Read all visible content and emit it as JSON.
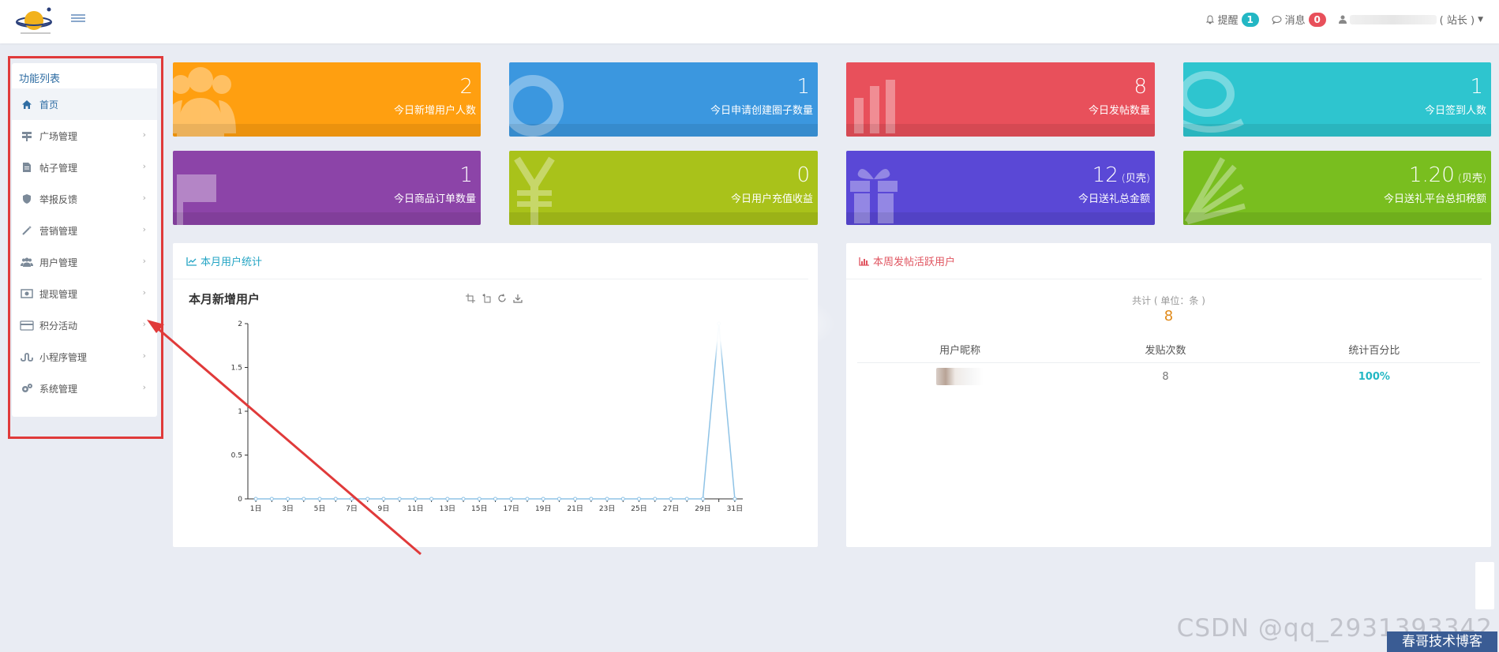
{
  "topbar": {
    "remind_label": "提醒",
    "remind_count": "1",
    "message_label": "消息",
    "message_count": "0",
    "role_label": "( 站长 )"
  },
  "sidebar": {
    "title": "功能列表",
    "items": [
      {
        "label": "首页",
        "icon": "home-icon"
      },
      {
        "label": "广场管理",
        "icon": "signpost-icon"
      },
      {
        "label": "帖子管理",
        "icon": "document-icon"
      },
      {
        "label": "举报反馈",
        "icon": "shield-icon"
      },
      {
        "label": "营销管理",
        "icon": "magic-wand-icon"
      },
      {
        "label": "用户管理",
        "icon": "users-icon"
      },
      {
        "label": "提现管理",
        "icon": "money-icon"
      },
      {
        "label": "积分活动",
        "icon": "credit-card-icon"
      },
      {
        "label": "小程序管理",
        "icon": "stumbleupon-icon"
      },
      {
        "label": "系统管理",
        "icon": "gears-icon"
      }
    ]
  },
  "cards": [
    {
      "value": "2",
      "unit": "",
      "label": "今日新增用户人数",
      "color": "#ff9f10",
      "icon": "users-icon"
    },
    {
      "value": "1",
      "unit": "",
      "label": "今日申请创建圈子数量",
      "color": "#3b97df",
      "icon": "circle-icon"
    },
    {
      "value": "8",
      "unit": "",
      "label": "今日发帖数量",
      "color": "#e8505b",
      "icon": "bar-chart-icon"
    },
    {
      "value": "1",
      "unit": "",
      "label": "今日签到人数",
      "color": "#2ec5cf",
      "icon": "ring-icon"
    },
    {
      "value": "1",
      "unit": "",
      "label": "今日商品订单数量",
      "color": "#8c44a8",
      "icon": "flag-icon"
    },
    {
      "value": "0",
      "unit": "",
      "label": "今日用户充值收益",
      "color": "#a9c21a",
      "icon": "yen-icon"
    },
    {
      "value": "12",
      "unit": "(贝壳)",
      "label": "今日送礼总金额",
      "color": "#5a48d6",
      "icon": "gift-icon"
    },
    {
      "value": "1.20",
      "unit": "(贝壳)",
      "label": "今日送礼平台总扣税额",
      "color": "#79be1f",
      "icon": "rays-icon"
    }
  ],
  "user_panel": {
    "header": "本月用户统计",
    "chart_title": "本月新增用户"
  },
  "post_panel": {
    "header": "本周发帖活跃用户",
    "summary_label": "共计 ( 单位：条 )",
    "summary_value": "8",
    "columns": [
      "用户昵称",
      "发贴次数",
      "统计百分比"
    ],
    "rows": [
      {
        "count": "8",
        "percent": "100%"
      }
    ]
  },
  "watermark": "CSDN @qq_2931393342",
  "watermark_badge": "春哥技术博客",
  "chart_data": {
    "type": "line",
    "title": "本月新增用户",
    "x": [
      "1日",
      "2日",
      "3日",
      "4日",
      "5日",
      "6日",
      "7日",
      "8日",
      "9日",
      "10日",
      "11日",
      "12日",
      "13日",
      "14日",
      "15日",
      "16日",
      "17日",
      "18日",
      "19日",
      "20日",
      "21日",
      "22日",
      "23日",
      "24日",
      "25日",
      "26日",
      "27日",
      "28日",
      "29日",
      "30日",
      "31日"
    ],
    "x_tick_labels": [
      "1日",
      "3日",
      "5日",
      "7日",
      "9日",
      "11日",
      "13日",
      "15日",
      "17日",
      "19日",
      "21日",
      "23日",
      "25日",
      "27日",
      "29日",
      "31日"
    ],
    "values": [
      0,
      0,
      0,
      0,
      0,
      0,
      0,
      0,
      0,
      0,
      0,
      0,
      0,
      0,
      0,
      0,
      0,
      0,
      0,
      0,
      0,
      0,
      0,
      0,
      0,
      0,
      0,
      0,
      0,
      2,
      0
    ],
    "ylim": [
      0,
      2
    ],
    "y_ticks": [
      0,
      0.5,
      1,
      1.5,
      2
    ],
    "color": "#8fc3e6"
  }
}
